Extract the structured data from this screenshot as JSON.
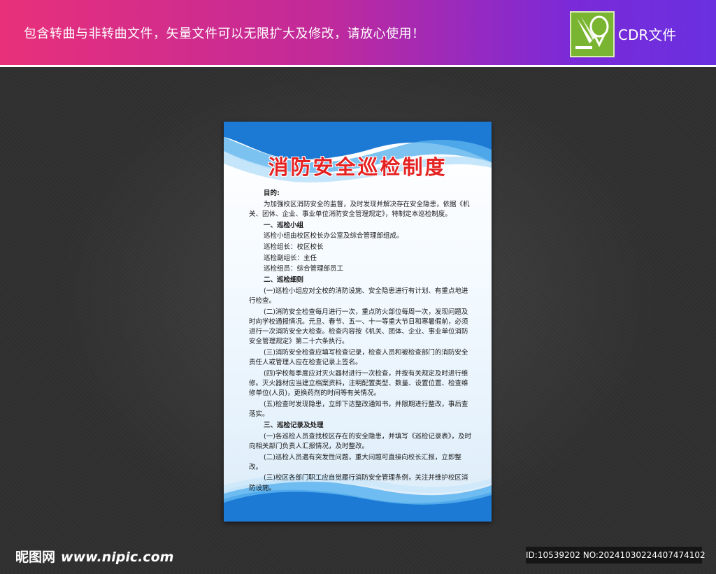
{
  "banner": {
    "text": "包含转曲与非转曲文件，矢量文件可以无限扩大及修改，请放心使用！",
    "format_label": "CDR文件",
    "logo_icon": "coreldraw-icon"
  },
  "poster": {
    "title": "消防安全巡检制度",
    "paragraphs": [
      "目的:",
      "为加强校区消防安全的监督，及时发现并解决存在安全隐患，依据《机关、团体、企业、事业单位消防安全管理规定》，特制定本巡检制度。",
      "一、巡检小组",
      "巡检小组由校区校长办公室及综合管理部组成。",
      "巡检组长：校区校长",
      "巡检副组长：主任",
      "巡检组员：综合管理部员工",
      "二、巡检细则",
      "(一)巡检小组应对全校的消防设施、安全隐患进行有计划、有重点地进行检查。",
      "(二)消防安全检查每月进行一次，重点防火部位每周一次，发现问题及时向学校通报情况。元旦、春节、五一、十一等重大节日和寒暑假前，必须进行一次消防安全大检查。检查内容按《机关、团体、企业、事业单位消防安全管理规定》第二十六条执行。",
      "(三)消防安全检查应填写检查记录，检查人员和被检查部门的消防安全责任人或管理人应在检查记录上签名。",
      "(四)学校每季度应对灭火器材进行一次检查，并按有关规定及时进行维修。灭火器材应当建立档案资料，注明配置类型、数量、设置位置、检查维修单位(人员)，更换药剂的时间等有关情况。",
      "(五)检查时发现隐患，立即下达整改通知书，并限期进行整改，事后查落实。",
      "三、巡检记录及处理",
      "(一)各巡检人员查找校区存在的安全隐患，并填写《巡检记录表》，及时向相关部门负责人汇报情况，及时整改。",
      "(二)巡检人员遇有突发性问题，重大问题可直接向校长汇报，立即整改。",
      "(三)校区各部门职工应自觉履行消防安全管理条例，关注并维护校区消防设施。"
    ]
  },
  "watermark": {
    "site_name": "昵图网",
    "site_url": "www.nipic.com",
    "id_text": "ID:10539202 NO:20241030224407474102"
  },
  "colors": {
    "title_red": "#e52222",
    "poster_blue": "#1f7fd6",
    "logo_green": "#7ab532"
  }
}
